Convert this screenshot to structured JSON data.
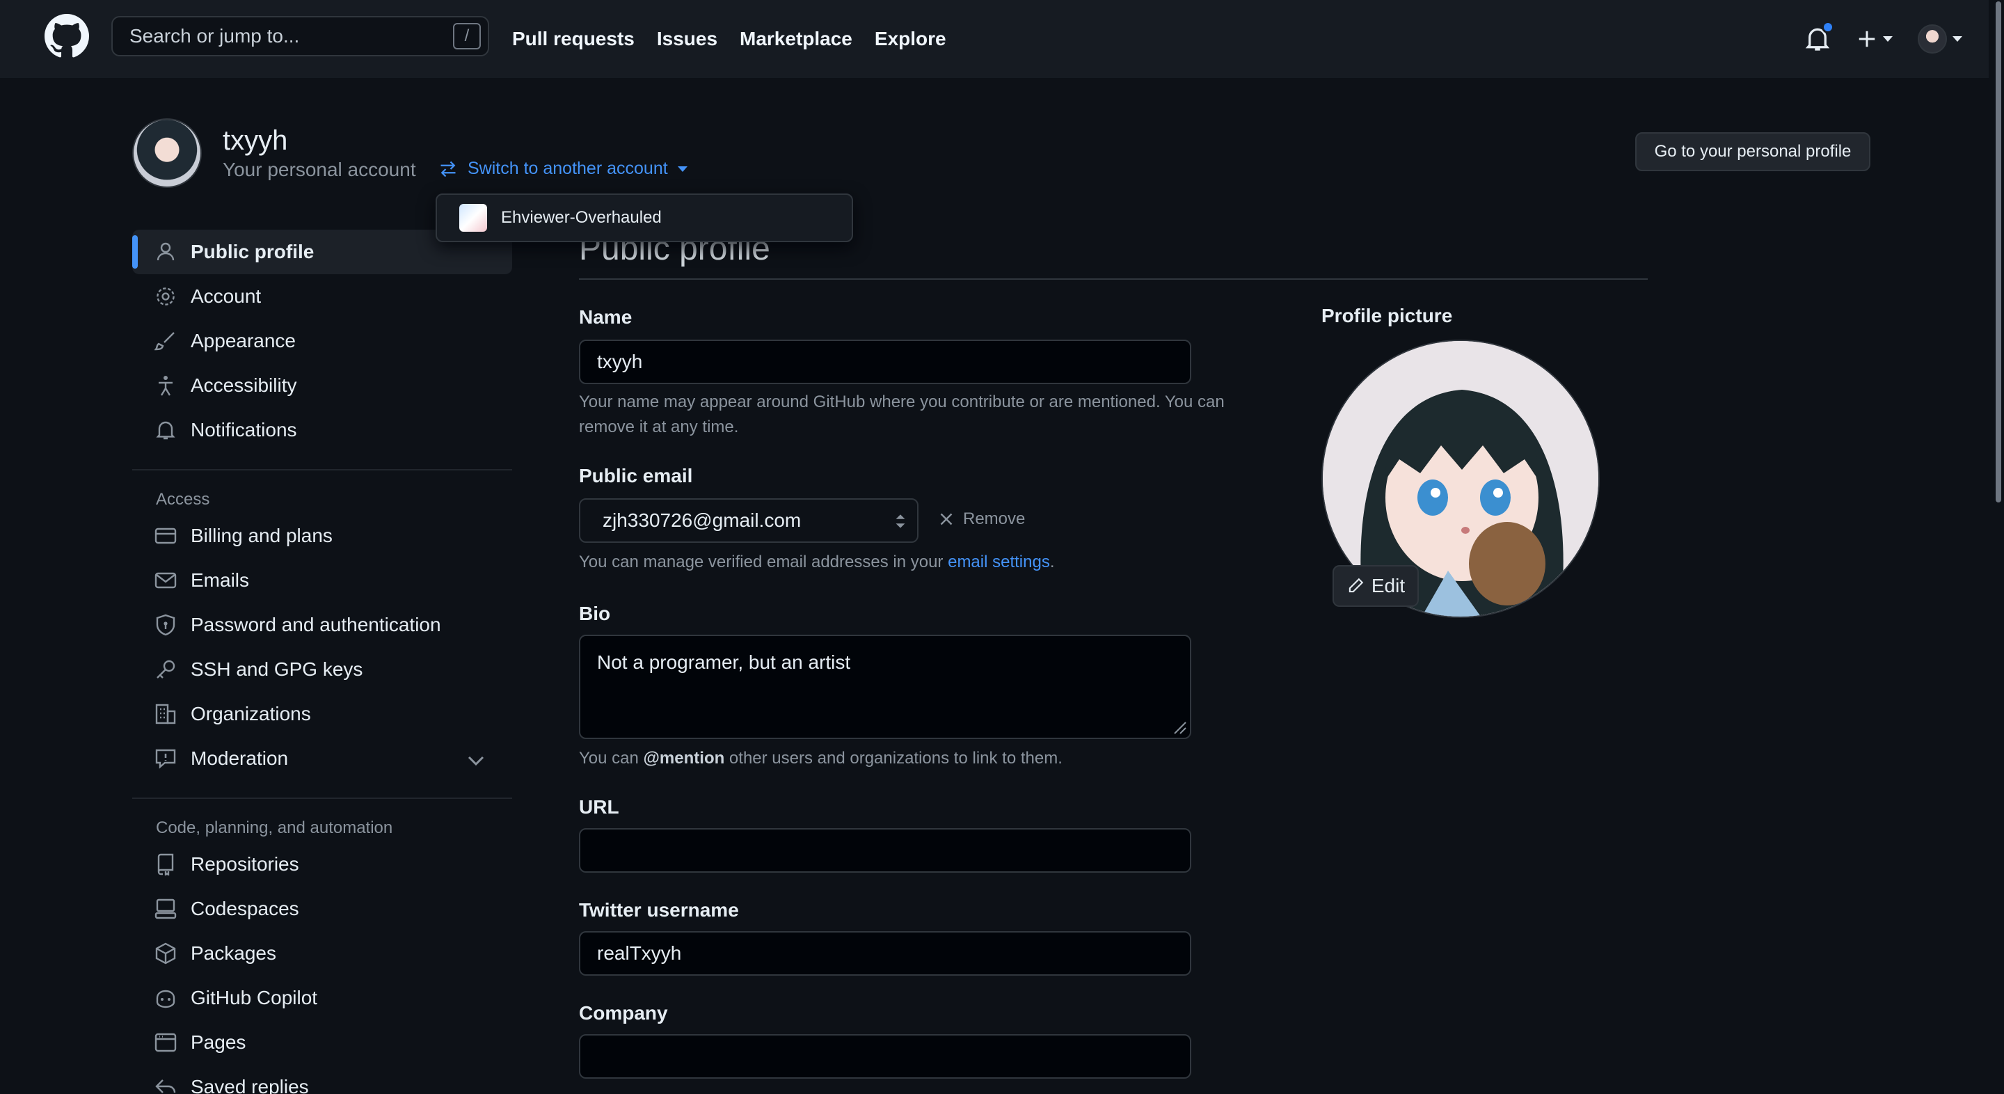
{
  "header": {
    "search_placeholder": "Search or jump to...",
    "search_shortcut": "/",
    "nav": [
      "Pull requests",
      "Issues",
      "Marketplace",
      "Explore"
    ]
  },
  "account": {
    "username": "txyyh",
    "subtitle": "Your personal account",
    "switch_label": "Switch to another account",
    "go_profile_label": "Go to your personal profile"
  },
  "dropdown": {
    "items": [
      "Ehviewer-Overhauled"
    ]
  },
  "sidebar": {
    "top_items": [
      "Public profile",
      "Account",
      "Appearance",
      "Accessibility",
      "Notifications"
    ],
    "access_heading": "Access",
    "access_items": [
      "Billing and plans",
      "Emails",
      "Password and authentication",
      "SSH and GPG keys",
      "Organizations",
      "Moderation"
    ],
    "code_heading": "Code, planning, and automation",
    "code_items": [
      "Repositories",
      "Codespaces",
      "Packages",
      "GitHub Copilot",
      "Pages",
      "Saved replies"
    ]
  },
  "main": {
    "title": "Public profile",
    "name_label": "Name",
    "name_value": "txyyh",
    "name_note_1": "Your name may appear around GitHub where you contribute or are mentioned. You can",
    "name_note_2": "remove it at any time.",
    "email_label": "Public email",
    "email_value": "zjh330726@gmail.com",
    "remove_label": "Remove",
    "email_note_prefix": "You can manage verified email addresses in your ",
    "email_note_link": "email settings",
    "email_note_suffix": ".",
    "bio_label": "Bio",
    "bio_value": "Not a programer, but an artist",
    "bio_note_prefix": "You can ",
    "bio_note_mention": "@mention",
    "bio_note_suffix": " other users and organizations to link to them.",
    "url_label": "URL",
    "url_value": "",
    "twitter_label": "Twitter username",
    "twitter_value": "realTxyyh",
    "company_label": "Company",
    "company_value": "",
    "picture_label": "Profile picture",
    "edit_label": "Edit"
  },
  "colors": {
    "background": "#0d1117",
    "header": "#161b22",
    "accent": "#4493f8",
    "border": "#30363d",
    "muted": "#8b949e"
  }
}
